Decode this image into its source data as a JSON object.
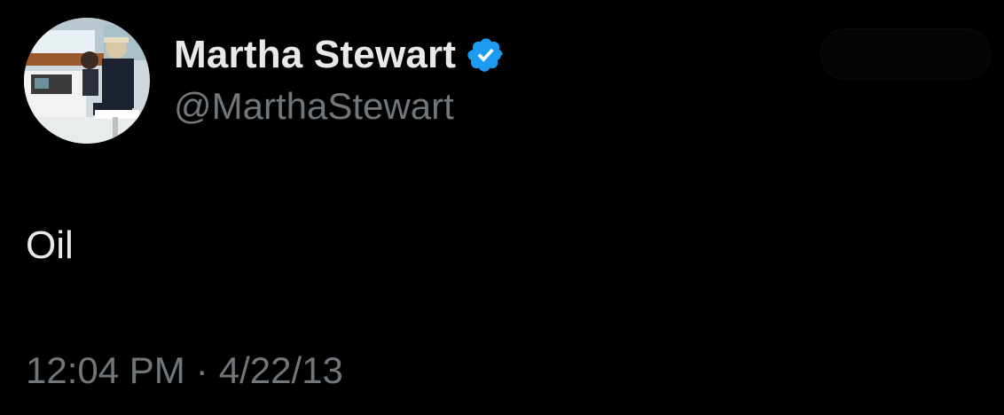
{
  "author": {
    "display_name": "Martha Stewart",
    "handle": "@MarthaStewart",
    "verified": true,
    "verified_badge_color": "#1d9bf0"
  },
  "tweet": {
    "text": "Oil",
    "time": "12:04 PM",
    "separator": "·",
    "date": "4/22/13"
  },
  "colors": {
    "background": "#000000",
    "primary_text": "#e7e9ea",
    "secondary_text": "#71767b"
  }
}
